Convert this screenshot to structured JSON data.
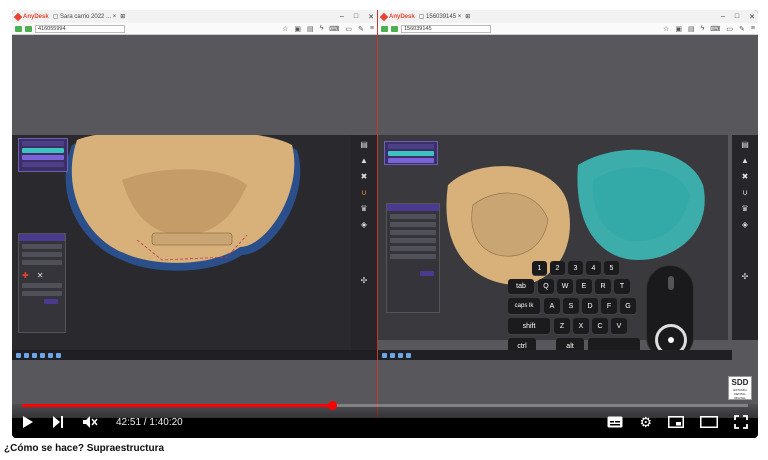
{
  "video": {
    "title": "¿Cómo se hace? Supraestructura",
    "time_current": "42:51",
    "time_total": "1:40:20",
    "progress_fraction": 0.427,
    "brand_badge": "SDD",
    "brand_badge_sub": "ESTUDIO DENTAL DIGITAL"
  },
  "panes": [
    {
      "app": "AnyDesk",
      "tab_title": "Sara carrio 2022 ...",
      "address": "416055994",
      "accent": "#e8432e"
    },
    {
      "app": "AnyDesk",
      "tab_title": "156039145",
      "address": "156039145",
      "accent": "#e8432e"
    }
  ],
  "keyboard": {
    "number_keys": [
      "1",
      "2",
      "3",
      "4",
      "5"
    ],
    "row1": [
      "tab",
      "Q",
      "W",
      "E",
      "R",
      "T"
    ],
    "row2": [
      "caps lk",
      "A",
      "S",
      "D",
      "F",
      "G"
    ],
    "row3": [
      "shift",
      "Z",
      "X",
      "C",
      "V"
    ],
    "row4": [
      "ctrl",
      "alt"
    ]
  },
  "icons": {
    "play": "play-icon",
    "next": "next-icon",
    "mute": "volume-muted-icon",
    "subtitles": "subtitles-icon",
    "settings": "gear-icon",
    "miniplayer": "miniplayer-icon",
    "theater": "theater-mode-icon",
    "fullscreen": "fullscreen-icon"
  },
  "colors": {
    "progress": "#ff0000",
    "model_gold": "#d8b07a",
    "model_teal": "#3ec2c0",
    "menu_purple": "#3b2f66"
  }
}
